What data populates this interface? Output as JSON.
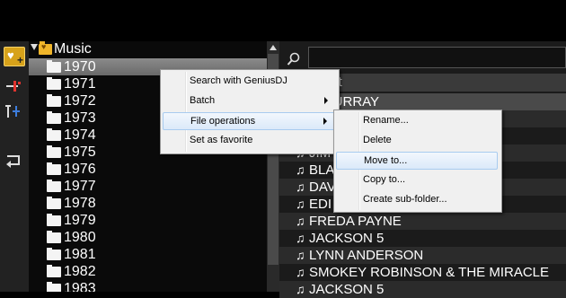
{
  "sidebar": {
    "root_label": "Music",
    "folders": [
      "1970",
      "1971",
      "1972",
      "1973",
      "1974",
      "1975",
      "1976",
      "1977",
      "1978",
      "1979",
      "1980",
      "1981",
      "1982",
      "1983"
    ],
    "selected_folder": "1970"
  },
  "tracks": {
    "header_partial": "st",
    "rows": [
      "E MURRAY",
      "",
      "",
      "JIM",
      "BLA",
      "DAV",
      "EDI",
      "FREDA PAYNE",
      "JACKSON 5",
      "LYNN ANDERSON",
      "SMOKEY ROBINSON & THE MIRACLE",
      "JACKSON 5"
    ]
  },
  "context_menu": {
    "items": [
      "Search with GeniusDJ",
      "Batch",
      "File operations",
      "Set as favorite"
    ]
  },
  "submenu": {
    "items": [
      "Rename...",
      "Delete",
      "Move to...",
      "Copy to...",
      "Create sub-folder..."
    ]
  },
  "colors": {
    "folder_accent": "#f0b52a",
    "menu_highlight": "#dbe9f9"
  }
}
